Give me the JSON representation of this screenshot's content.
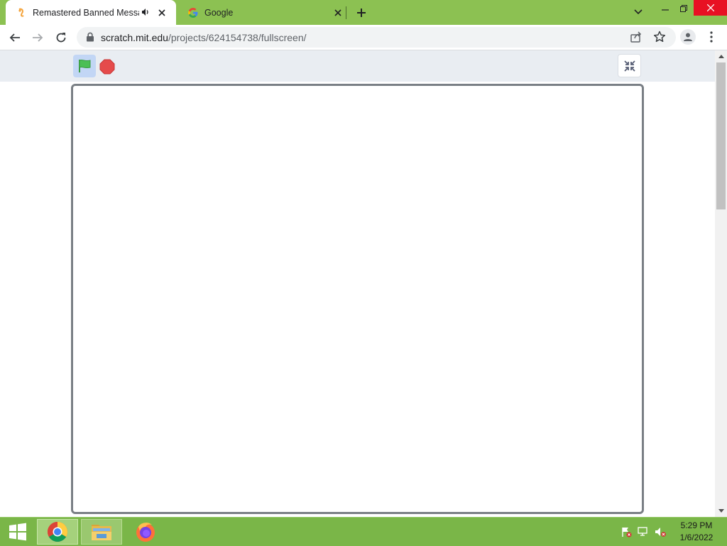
{
  "browser": {
    "tabs": [
      {
        "title": "Remastered Banned Messag",
        "favicon": "scratch-cat-icon",
        "audio": true,
        "active": true
      },
      {
        "title": "Google",
        "favicon": "google-g-icon",
        "active": false
      }
    ],
    "url_host": "scratch.mit.edu",
    "url_path": "/projects/624154738/fullscreen/"
  },
  "page": {
    "green_flag_icon": "green-flag-icon",
    "stop_icon": "stop-sign-icon",
    "exit_fullscreen_icon": "unfullscreen-icon"
  },
  "taskbar": {
    "time": "5:29 PM",
    "date": "1/6/2022",
    "pinned": [
      "chrome-icon",
      "file-explorer-icon",
      "firefox-icon"
    ]
  },
  "colors": {
    "tab_strip": "#8cc152",
    "taskbar": "#7ab648",
    "close_window": "#e81123",
    "flag_active_bg": "#c2d6f5",
    "stop_red": "#e54b4b",
    "flag_green": "#4cbf56"
  }
}
